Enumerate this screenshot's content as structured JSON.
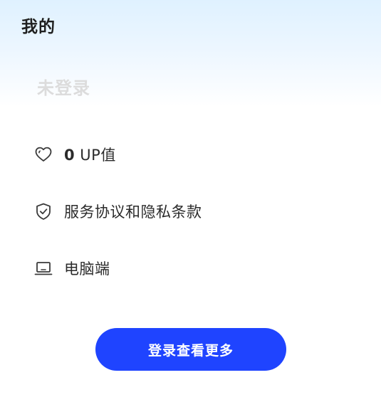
{
  "header": {
    "title": "我的"
  },
  "profile": {
    "login_status": "未登录"
  },
  "menu": {
    "items": [
      {
        "icon": "heart-icon",
        "value": "0",
        "label": " UP值"
      },
      {
        "icon": "shield-check-icon",
        "label": "服务协议和隐私条款"
      },
      {
        "icon": "laptop-icon",
        "label": "电脑端"
      }
    ]
  },
  "actions": {
    "login_button_label": "登录查看更多"
  },
  "colors": {
    "accent": "#1f44ff",
    "gradient_top": "#dff1ff",
    "muted_text": "#dcdcdc",
    "text": "#2b2b2b"
  }
}
